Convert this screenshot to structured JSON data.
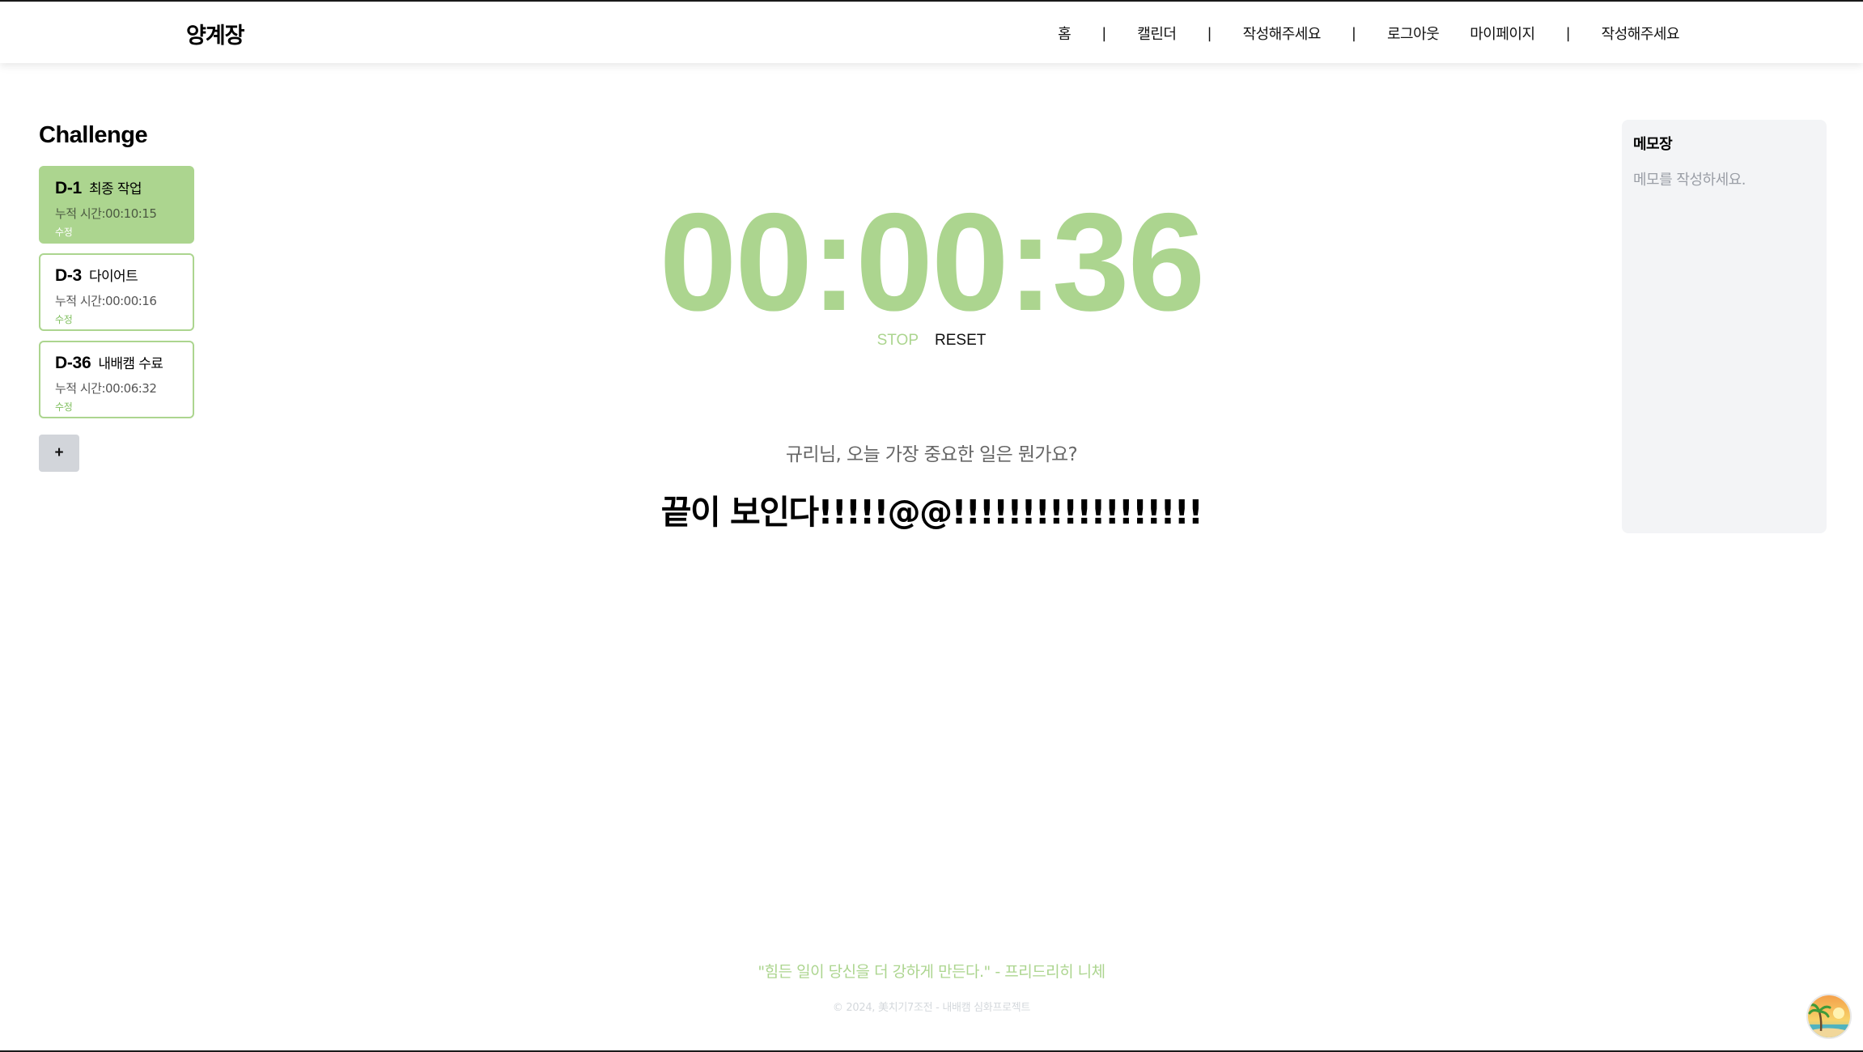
{
  "header": {
    "logo": "양계장",
    "nav": [
      "홈",
      "캘린더",
      "작성해주세요",
      "로그아웃",
      "마이페이지",
      "작성해주세요"
    ],
    "separator": "|"
  },
  "challenge": {
    "title": "Challenge",
    "items": [
      {
        "dday": "D-1",
        "name": "최종 작업",
        "accumulated": "누적 시간:00:10:15",
        "edit": "수정",
        "active": true
      },
      {
        "dday": "D-3",
        "name": "다이어트",
        "accumulated": "누적 시간:00:00:16",
        "edit": "수정",
        "active": false
      },
      {
        "dday": "D-36",
        "name": "내배캠 수료",
        "accumulated": "누적 시간:00:06:32",
        "edit": "수정",
        "active": false
      }
    ],
    "add_label": "+"
  },
  "timer": {
    "display": "00:00:36",
    "stop_label": "STOP",
    "reset_label": "RESET"
  },
  "main": {
    "question": "규리님, 오늘 가장 중요한 일은 뭔가요?",
    "answer": "끝이 보인다!!!!!@@!!!!!!!!!!!!!!!!!!"
  },
  "memo": {
    "title": "메모장",
    "placeholder": "메모를 작성하세요."
  },
  "footer": {
    "quote": "\"힘든 일이 당신을 더 강하게 만든다.\" - 프리드리히 니체",
    "copyright": "© 2024, 美치기7조전 - 내배캠 심화프로젝트"
  },
  "colors": {
    "accent": "#acd58f",
    "memo_bg": "#f3f4f6",
    "add_button_bg": "#d2d5da"
  }
}
